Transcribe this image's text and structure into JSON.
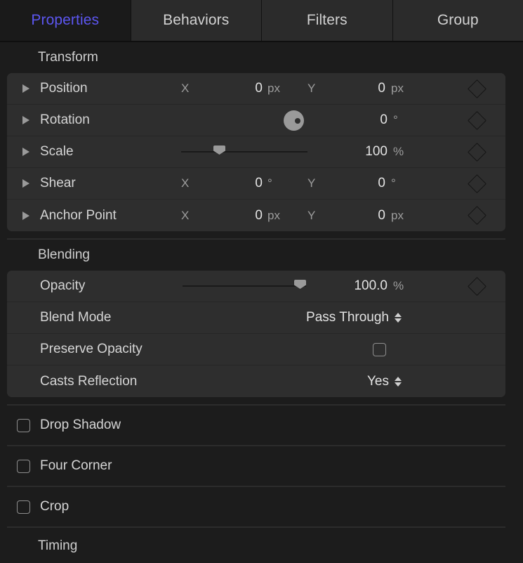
{
  "tabs": [
    {
      "label": "Properties",
      "active": true
    },
    {
      "label": "Behaviors",
      "active": false
    },
    {
      "label": "Filters",
      "active": false
    },
    {
      "label": "Group",
      "active": false
    }
  ],
  "sections": {
    "transform": {
      "title": "Transform",
      "rows": {
        "position": {
          "label": "Position",
          "x_axis": "X",
          "x_value": "0",
          "x_unit": "px",
          "y_axis": "Y",
          "y_value": "0",
          "y_unit": "px"
        },
        "rotation": {
          "label": "Rotation",
          "value": "0",
          "unit": "°"
        },
        "scale": {
          "label": "Scale",
          "value": "100",
          "unit": "%",
          "slider_percent": 28
        },
        "shear": {
          "label": "Shear",
          "x_axis": "X",
          "x_value": "0",
          "x_unit": "°",
          "y_axis": "Y",
          "y_value": "0",
          "y_unit": "°"
        },
        "anchor_point": {
          "label": "Anchor Point",
          "x_axis": "X",
          "x_value": "0",
          "x_unit": "px",
          "y_axis": "Y",
          "y_value": "0",
          "y_unit": "px"
        }
      }
    },
    "blending": {
      "title": "Blending",
      "rows": {
        "opacity": {
          "label": "Opacity",
          "value": "100.0",
          "unit": "%",
          "slider_percent": 100
        },
        "blend_mode": {
          "label": "Blend Mode",
          "value": "Pass Through"
        },
        "preserve_opacity": {
          "label": "Preserve Opacity",
          "checked": false
        },
        "casts_reflection": {
          "label": "Casts Reflection",
          "value": "Yes"
        }
      }
    },
    "toggles": [
      {
        "label": "Drop Shadow",
        "checked": false
      },
      {
        "label": "Four Corner",
        "checked": false
      },
      {
        "label": "Crop",
        "checked": false
      }
    ],
    "timing": {
      "title": "Timing"
    }
  },
  "colors": {
    "accent": "#5c56f0",
    "panel_bg": "#1c1c1c",
    "row_bg": "#2e2e2e",
    "text": "#d5d5d5",
    "muted_text": "#9d9d9d",
    "control": "#9a9a9a"
  }
}
